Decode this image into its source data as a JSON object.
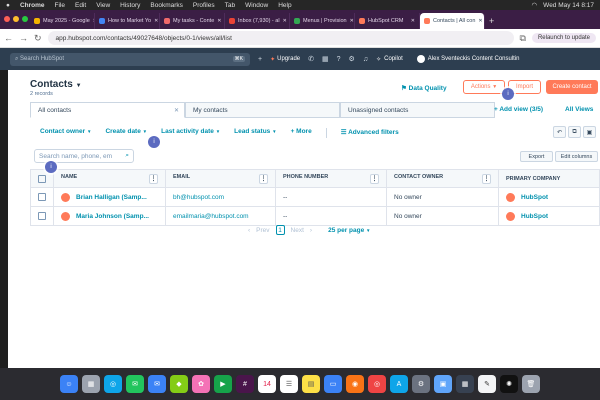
{
  "menubar": {
    "app": "Chrome",
    "items": [
      "File",
      "Edit",
      "View",
      "History",
      "Bookmarks",
      "Profiles",
      "Tab",
      "Window",
      "Help"
    ],
    "clock": "Wed May 14 8:17"
  },
  "tabs": [
    {
      "label": "May 2025 - Google",
      "color": "#f4b400"
    },
    {
      "label": "How to Market Yo",
      "color": "#4285f4"
    },
    {
      "label": "My tasks - Conte",
      "color": "#f06a6a"
    },
    {
      "label": "Inbox (7,930) - al",
      "color": "#ea4335"
    },
    {
      "label": "Menus | Provision",
      "color": "#34a853"
    },
    {
      "label": "HubSpot CRM",
      "color": "#ff7a59"
    },
    {
      "label": "Contacts | All con",
      "color": "#ff7a59",
      "active": true
    }
  ],
  "address": {
    "url": "app.hubspot.com/contacts/49027648/objects/0-1/views/all/list",
    "relaunch": "Relaunch to update"
  },
  "hsnav": {
    "search_placeholder": "Search HubSpot",
    "search_key": "⌘K",
    "upgrade": "Upgrade",
    "copilot": "Copilot",
    "account": "Alex Sventeckis Content Consultin"
  },
  "header": {
    "title": "Contacts",
    "records": "2 records",
    "data_quality": "Data Quality",
    "actions": "Actions",
    "import": "Import",
    "create": "Create contact"
  },
  "views": {
    "tabs": [
      "All contacts",
      "My contacts",
      "Unassigned contacts"
    ],
    "add_view": "+ Add view (3/5)",
    "all_views": "All Views"
  },
  "filters": {
    "owner": "Contact owner",
    "create_date": "Create date",
    "last_activity": "Last activity date",
    "lead_status": "Lead status",
    "more": "+ More",
    "advanced": "Advanced filters"
  },
  "table_tools": {
    "search_placeholder": "Search name, phone, em",
    "export": "Export",
    "edit_columns": "Edit columns"
  },
  "table": {
    "columns": [
      "NAME",
      "EMAIL",
      "PHONE NUMBER",
      "CONTACT OWNER",
      "PRIMARY COMPANY"
    ],
    "rows": [
      {
        "name": "Brian Halligan (Samp...",
        "email": "bh@hubspot.com",
        "phone": "--",
        "owner": "No owner",
        "company": "HubSpot"
      },
      {
        "name": "Maria Johnson (Samp...",
        "email": "emailmaria@hubspot.com",
        "phone": "--",
        "owner": "No owner",
        "company": "HubSpot"
      }
    ]
  },
  "pager": {
    "prev": "Prev",
    "current": "1",
    "next": "Next",
    "per_page": "25 per page"
  },
  "markers": [
    "i",
    "i",
    "i"
  ]
}
